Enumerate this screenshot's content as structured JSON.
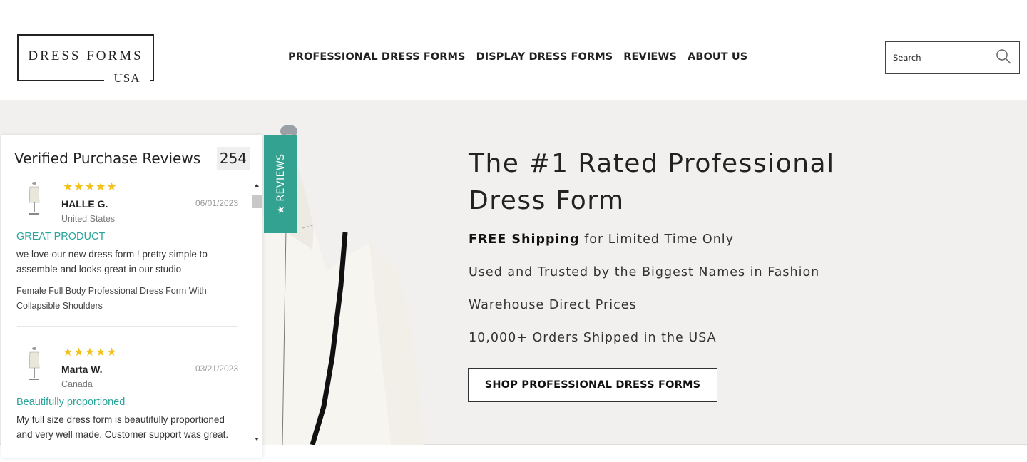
{
  "logo": {
    "line1": "DRESS FORMS",
    "line2": "USA"
  },
  "nav": [
    {
      "label": "PROFESSIONAL DRESS FORMS"
    },
    {
      "label": "DISPLAY DRESS FORMS"
    },
    {
      "label": "REVIEWS"
    },
    {
      "label": "ABOUT US"
    }
  ],
  "search": {
    "placeholder": "Search",
    "icon": "search-icon"
  },
  "hero": {
    "title_line1": "The #1 Rated Professional",
    "title_line2": "Dress Form",
    "shipping_bold": "FREE Shipping",
    "shipping_rest": " for Limited Time Only",
    "line2": "Used and Trusted by the Biggest Names in Fashion",
    "line3": "Warehouse Direct Prices",
    "line4": "10,000+ Orders Shipped in the USA",
    "cta": "SHOP PROFESSIONAL DRESS FORMS",
    "background": "#f1f0ee"
  },
  "reviews_widget": {
    "title": "Verified Purchase Reviews",
    "count": "254",
    "tab_label": "★ REVIEWS",
    "tab_color": "#34a291",
    "star_color": "#f2c21b",
    "headline_color": "#2aa59a",
    "items": [
      {
        "stars": "★★★★★",
        "name": "HALLE G.",
        "date": "06/01/2023",
        "country": "United States",
        "headline": "GREAT PRODUCT",
        "body": "we love our new dress form ! pretty simple to assemble and looks great in our studio",
        "product": "Female Full Body Professional Dress Form With Collapsible Shoulders"
      },
      {
        "stars": "★★★★★",
        "name": "Marta W.",
        "date": "03/21/2023",
        "country": "Canada",
        "headline": "Beautifully proportioned",
        "body": "My full size dress form is beautifully proportioned and very well made. Customer support was great."
      }
    ]
  }
}
